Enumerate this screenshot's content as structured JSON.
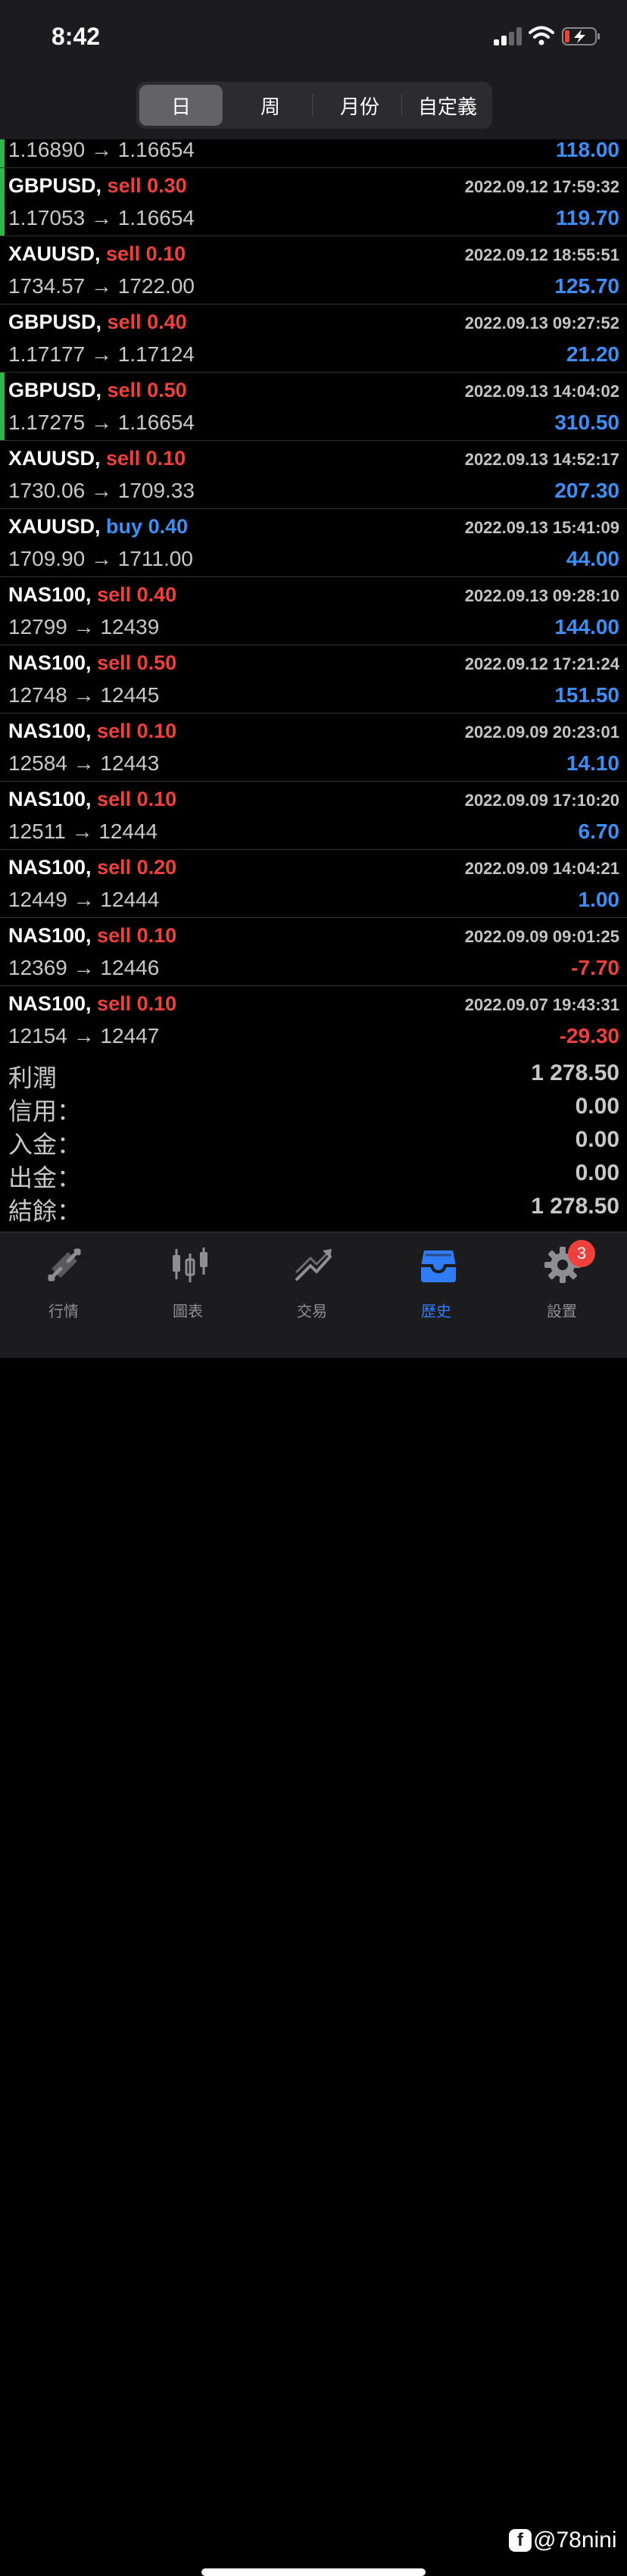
{
  "status_bar": {
    "time": "8:42"
  },
  "header": {
    "segments": [
      "日",
      "周",
      "月份",
      "自定義"
    ],
    "active_index": 0
  },
  "partial_row": {
    "prices": "1.16890 → 1.16654",
    "profit": "118.00"
  },
  "trades": [
    {
      "symbol": "GBPUSD,",
      "side": "sell",
      "volume": "0.30",
      "prices": "1.17053 → 1.16654",
      "time": "2022.09.12 17:59:32",
      "profit": "119.70",
      "marker": true
    },
    {
      "symbol": "XAUUSD,",
      "side": "sell",
      "volume": "0.10",
      "prices": "1734.57 → 1722.00",
      "time": "2022.09.12 18:55:51",
      "profit": "125.70",
      "marker": false
    },
    {
      "symbol": "GBPUSD,",
      "side": "sell",
      "volume": "0.40",
      "prices": "1.17177 → 1.17124",
      "time": "2022.09.13 09:27:52",
      "profit": "21.20",
      "marker": false
    },
    {
      "symbol": "GBPUSD,",
      "side": "sell",
      "volume": "0.50",
      "prices": "1.17275 → 1.16654",
      "time": "2022.09.13 14:04:02",
      "profit": "310.50",
      "marker": true
    },
    {
      "symbol": "XAUUSD,",
      "side": "sell",
      "volume": "0.10",
      "prices": "1730.06 → 1709.33",
      "time": "2022.09.13 14:52:17",
      "profit": "207.30",
      "marker": false
    },
    {
      "symbol": "XAUUSD,",
      "side": "buy",
      "volume": "0.40",
      "prices": "1709.90 → 1711.00",
      "time": "2022.09.13 15:41:09",
      "profit": "44.00",
      "marker": false
    },
    {
      "symbol": "NAS100,",
      "side": "sell",
      "volume": "0.40",
      "prices": "12799 → 12439",
      "time": "2022.09.13 09:28:10",
      "profit": "144.00",
      "marker": false
    },
    {
      "symbol": "NAS100,",
      "side": "sell",
      "volume": "0.50",
      "prices": "12748 → 12445",
      "time": "2022.09.12 17:21:24",
      "profit": "151.50",
      "marker": false
    },
    {
      "symbol": "NAS100,",
      "side": "sell",
      "volume": "0.10",
      "prices": "12584 → 12443",
      "time": "2022.09.09 20:23:01",
      "profit": "14.10",
      "marker": false
    },
    {
      "symbol": "NAS100,",
      "side": "sell",
      "volume": "0.10",
      "prices": "12511 → 12444",
      "time": "2022.09.09 17:10:20",
      "profit": "6.70",
      "marker": false
    },
    {
      "symbol": "NAS100,",
      "side": "sell",
      "volume": "0.20",
      "prices": "12449 → 12444",
      "time": "2022.09.09 14:04:21",
      "profit": "1.00",
      "marker": false
    },
    {
      "symbol": "NAS100,",
      "side": "sell",
      "volume": "0.10",
      "prices": "12369 → 12446",
      "time": "2022.09.09 09:01:25",
      "profit": "-7.70",
      "marker": false
    },
    {
      "symbol": "NAS100,",
      "side": "sell",
      "volume": "0.10",
      "prices": "12154 → 12447",
      "time": "2022.09.07 19:43:31",
      "profit": "-29.30",
      "marker": false
    }
  ],
  "summary": [
    {
      "label": "利潤",
      "value": "1 278.50"
    },
    {
      "label": "信用：",
      "value": "0.00"
    },
    {
      "label": "入金：",
      "value": "0.00"
    },
    {
      "label": "出金：",
      "value": "0.00"
    },
    {
      "label": "結餘：",
      "value": "1 278.50"
    }
  ],
  "tabs": [
    {
      "label": "行情",
      "icon": "quotes-arrows-icon"
    },
    {
      "label": "圖表",
      "icon": "candlestick-chart-icon"
    },
    {
      "label": "交易",
      "icon": "trade-trend-icon"
    },
    {
      "label": "歷史",
      "icon": "history-tray-icon"
    },
    {
      "label": "設置",
      "icon": "gear-icon"
    }
  ],
  "active_tab": 3,
  "settings_badge": "3",
  "watermark": "@78nini",
  "colors": {
    "sell": "#f0403c",
    "buy": "#3d8ef5",
    "profit_positive": "#3d8ef5",
    "profit_negative": "#f0403c",
    "marker": "#2fb84a",
    "active_tab": "#2f7cf6"
  }
}
